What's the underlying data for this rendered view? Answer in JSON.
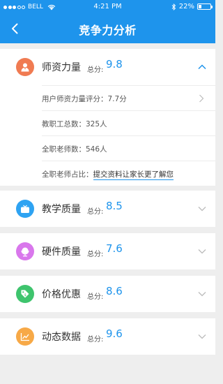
{
  "status_bar": {
    "carrier": "BELL",
    "time": "4:21 PM",
    "battery": "22%",
    "battery_level": 0.22
  },
  "header": {
    "title": "竞争力分析"
  },
  "score_label": "总分:",
  "colors": {
    "brand": "#1e94ec",
    "teacher": "#f07b52",
    "teaching": "#2ea3f2",
    "hardware": "#d977ec",
    "price": "#3ec46d",
    "dynamic": "#f7a947"
  },
  "sections": [
    {
      "title": "师资力量",
      "score": "9.8",
      "icon": "person-icon",
      "expanded": true
    },
    {
      "title": "教学质量",
      "score": "8.5",
      "icon": "tv-icon",
      "expanded": false
    },
    {
      "title": "硬件质量",
      "score": "7.6",
      "icon": "globe-icon",
      "expanded": false
    },
    {
      "title": "价格优惠",
      "score": "8.6",
      "icon": "tag-icon",
      "expanded": false
    },
    {
      "title": "动态数据",
      "score": "9.6",
      "icon": "chart-icon",
      "expanded": false
    }
  ],
  "teacher_details": {
    "rating": "用户师资力量评分：7.7分",
    "staff_total": "教职工总数：325人",
    "fulltime_teachers": "全职老师数：546人",
    "fulltime_ratio_label": "全职老师占比：",
    "fulltime_ratio_link": "提交资料让家长更了解您"
  }
}
